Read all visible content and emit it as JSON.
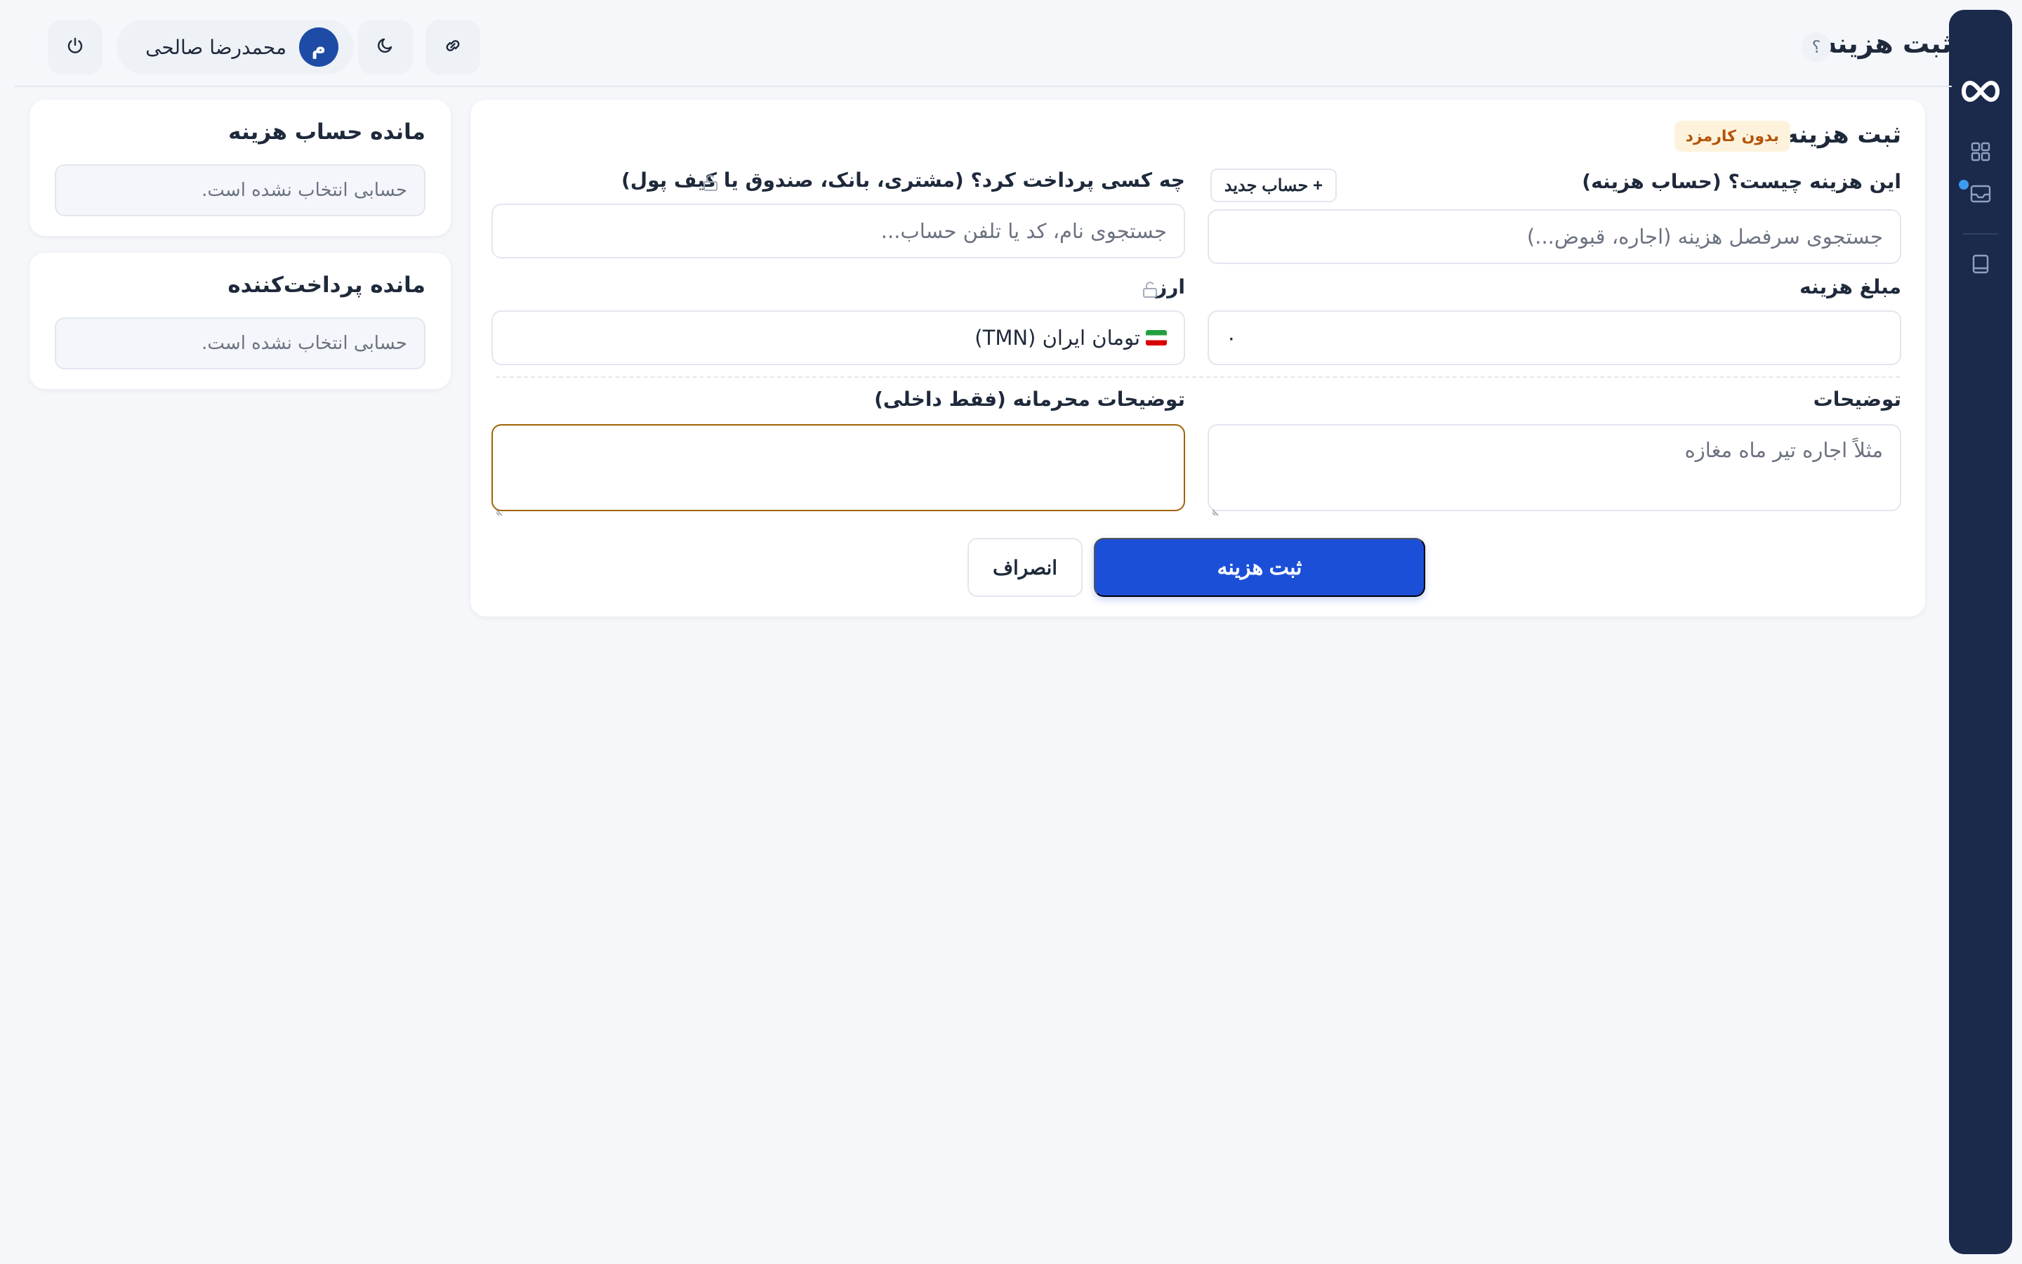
{
  "header": {
    "title": "ثبت هزینه",
    "help_label": "؟",
    "user_name": "محمدرضا صالحی",
    "user_initial": "م"
  },
  "form": {
    "card_title": "ثبت هزینه",
    "badge": "بدون کارمزد",
    "expense_account": {
      "label": "این هزینه چیست؟ (حساب هزینه)",
      "placeholder": "جستجوی سرفصل هزینه (اجاره، قبوض...)",
      "new_account_label": "+ حساب جدید"
    },
    "payer": {
      "label": "چه کسی پرداخت کرد؟ (مشتری، بانک، صندوق یا کیف پول)",
      "placeholder": "جستجوی نام، کد یا تلفن حساب..."
    },
    "amount": {
      "label": "مبلغ هزینه",
      "value": "۰"
    },
    "currency": {
      "label": "ارز",
      "value": "تومان ایران (TMN)"
    },
    "description": {
      "label": "توضیحات",
      "placeholder": "مثلاً اجاره تیر ماه مغازه"
    },
    "private_notes": {
      "label": "توضیحات محرمانه (فقط داخلی)",
      "value": ""
    },
    "submit_label": "ثبت هزینه",
    "cancel_label": "انصراف"
  },
  "side": {
    "expense_balance": {
      "title": "مانده حساب هزینه",
      "empty_text": "حسابی انتخاب نشده است."
    },
    "payer_balance": {
      "title": "مانده پرداخت‌کننده",
      "empty_text": "حسابی انتخاب نشده است."
    }
  },
  "colors": {
    "rail": "#1b2a4a",
    "primary": "#1c4fd8",
    "badge_bg": "#fdf3dc",
    "badge_text": "#b45309",
    "focus_border": "#a16207",
    "notification_dot": "#3b9bf1"
  },
  "icons": {
    "rail": [
      "infinity-logo-icon",
      "grid-icon",
      "inbox-icon",
      "book-icon"
    ],
    "header": [
      "power-icon",
      "moon-icon",
      "link-icon"
    ],
    "form": [
      "lock-icon"
    ]
  }
}
